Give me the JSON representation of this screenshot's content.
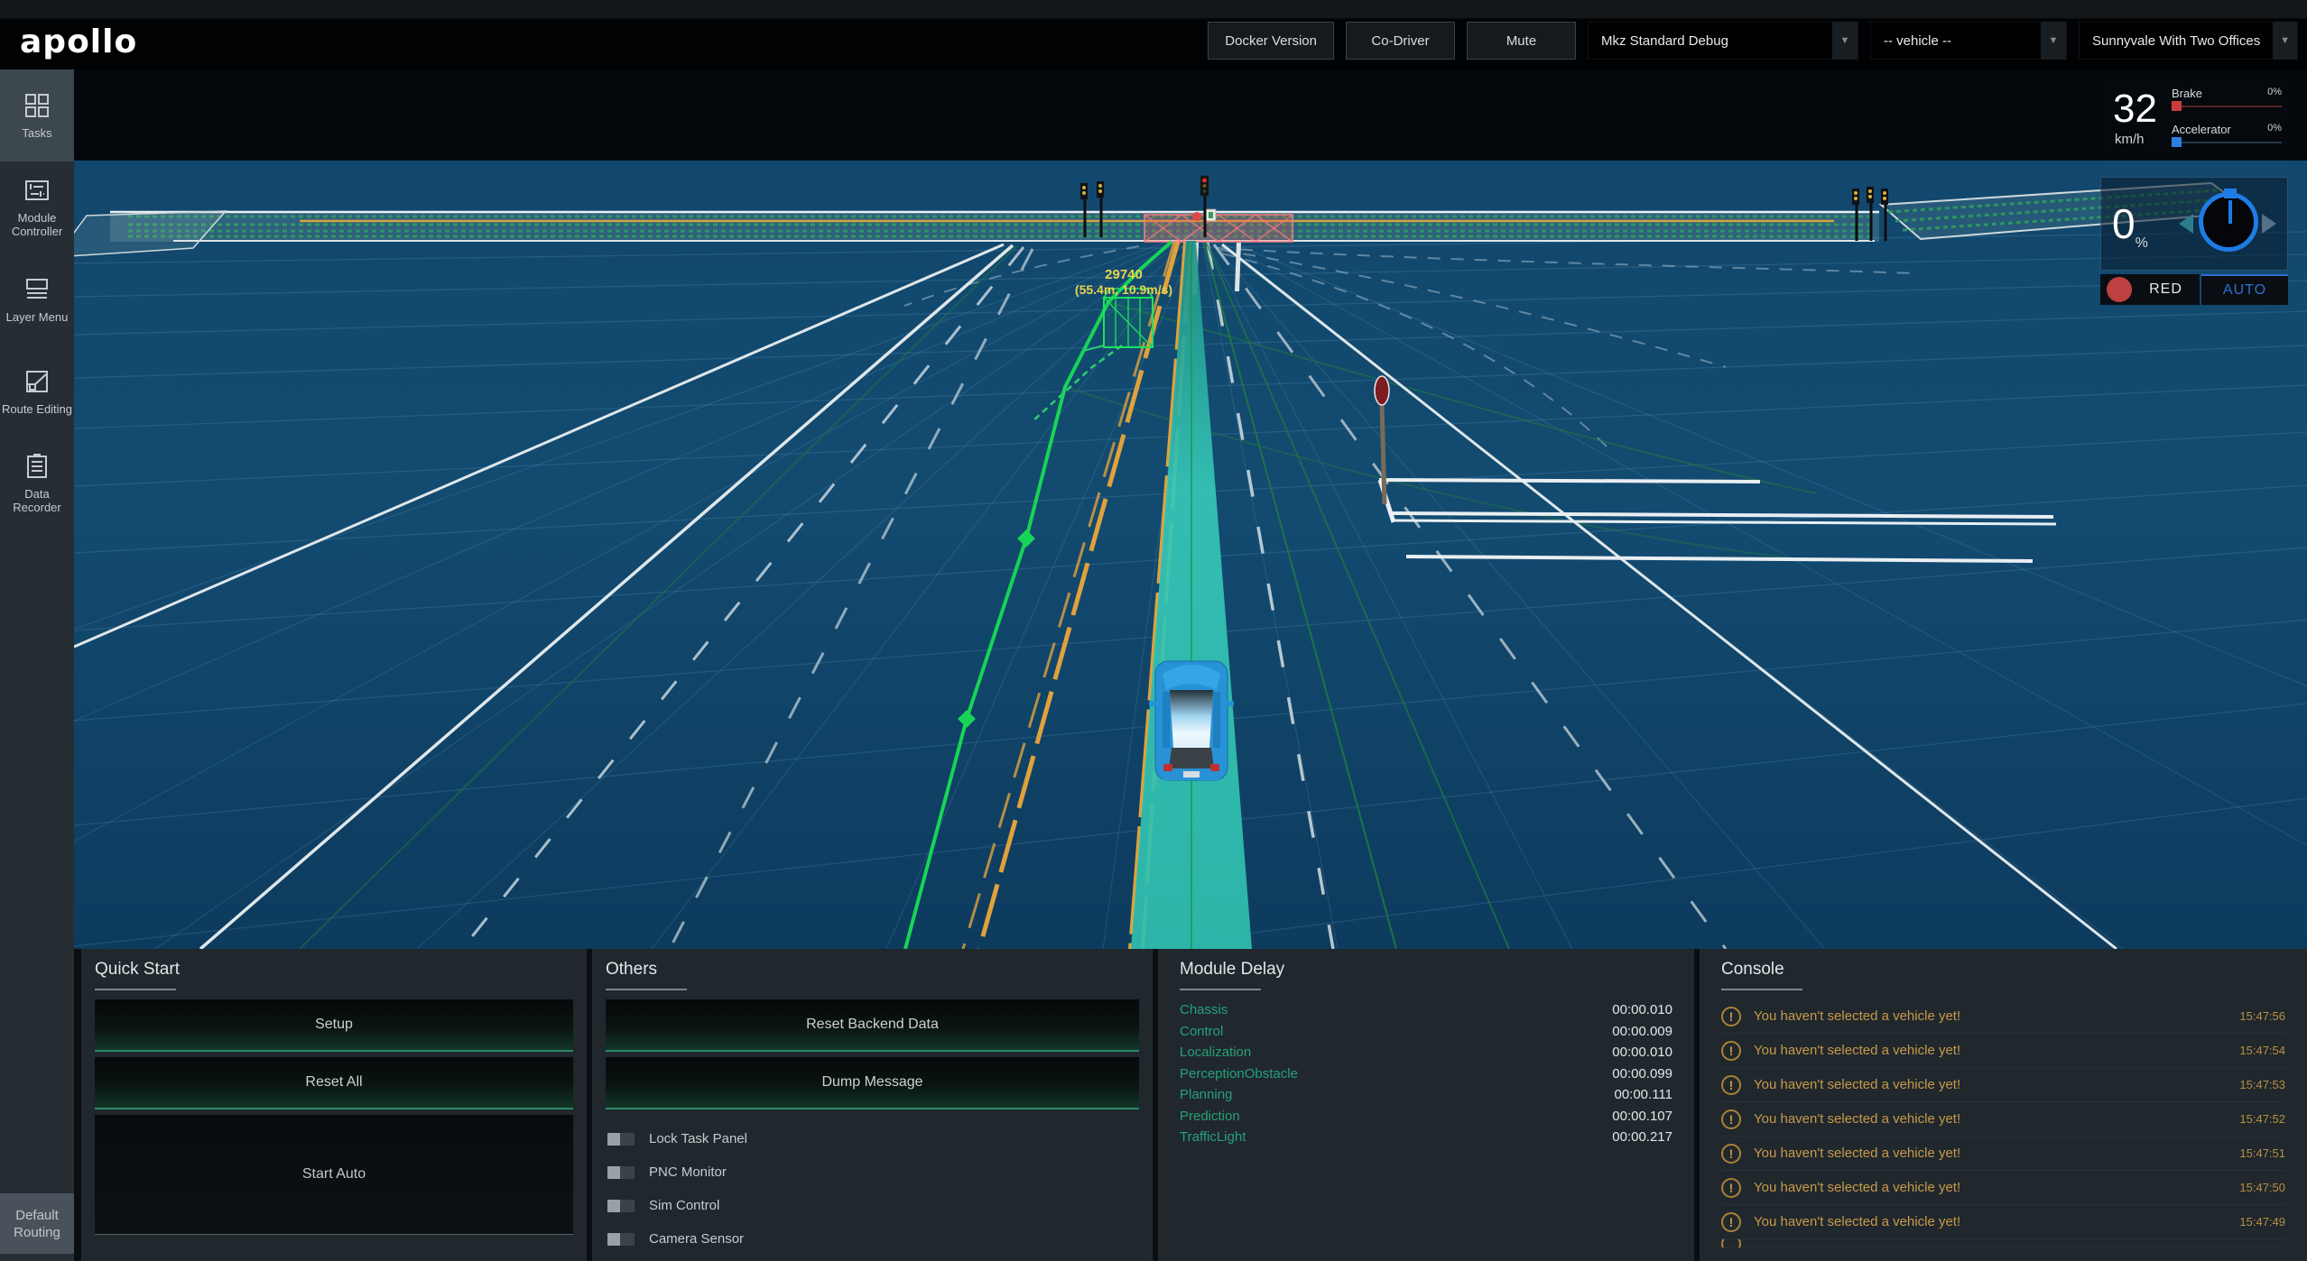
{
  "topbar": {
    "logo": "apollo",
    "buttons": [
      {
        "label": "Docker Version"
      },
      {
        "label": "Co-Driver"
      },
      {
        "label": "Mute"
      }
    ],
    "selects": [
      {
        "value": "Mkz Standard Debug"
      },
      {
        "value": "-- vehicle --"
      },
      {
        "value": "Sunnyvale With Two Offices"
      }
    ],
    "dropdown_arrow": "▼"
  },
  "sidebar": {
    "items": [
      {
        "label": "Tasks"
      },
      {
        "label": "Module Controller"
      },
      {
        "label": "Layer Menu"
      },
      {
        "label": "Route Editing"
      },
      {
        "label": "Data Recorder"
      }
    ],
    "footer": "Default Routing"
  },
  "dashboard": {
    "speed_value": "32",
    "speed_unit": "km/h",
    "brake_label": "Brake",
    "brake_value": "0%",
    "accelerator_label": "Accelerator",
    "accelerator_value": "0%",
    "steering_value": "0",
    "steering_unit": "%",
    "signal_label": "RED",
    "mode_label": "AUTO"
  },
  "scene": {
    "obstacle_id": "29740",
    "obstacle_info": "(55.4m, 10.9m/s)"
  },
  "panels": {
    "quick_start": {
      "title": "Quick Start",
      "buttons": [
        {
          "label": "Setup"
        },
        {
          "label": "Reset All"
        },
        {
          "label": "Start Auto"
        }
      ]
    },
    "others": {
      "title": "Others",
      "buttons": [
        {
          "label": "Reset Backend Data"
        },
        {
          "label": "Dump Message"
        }
      ],
      "toggles": [
        {
          "label": "Lock Task Panel",
          "on": false
        },
        {
          "label": "PNC Monitor",
          "on": false
        },
        {
          "label": "Sim Control",
          "on": false
        },
        {
          "label": "Camera Sensor",
          "on": false
        }
      ]
    },
    "module_delay": {
      "title": "Module Delay",
      "rows": [
        {
          "name": "Chassis",
          "value": "00:00.010"
        },
        {
          "name": "Control",
          "value": "00:00.009"
        },
        {
          "name": "Localization",
          "value": "00:00.010"
        },
        {
          "name": "PerceptionObstacle",
          "value": "00:00.099"
        },
        {
          "name": "Planning",
          "value": "00:00.111"
        },
        {
          "name": "Prediction",
          "value": "00:00.107"
        },
        {
          "name": "TrafficLight",
          "value": "00:00.217"
        }
      ]
    },
    "console": {
      "title": "Console",
      "warning_glyph": "!",
      "entries": [
        {
          "message": "You haven't selected a vehicle yet!",
          "time": "15:47:56"
        },
        {
          "message": "You haven't selected a vehicle yet!",
          "time": "15:47:54"
        },
        {
          "message": "You haven't selected a vehicle yet!",
          "time": "15:47:53"
        },
        {
          "message": "You haven't selected a vehicle yet!",
          "time": "15:47:52"
        },
        {
          "message": "You haven't selected a vehicle yet!",
          "time": "15:47:51"
        },
        {
          "message": "You haven't selected a vehicle yet!",
          "time": "15:47:50"
        },
        {
          "message": "You haven't selected a vehicle yet!",
          "time": "15:47:49"
        }
      ]
    }
  },
  "colors": {
    "accent_green": "#26a07b",
    "warning_amber": "#c89a4a",
    "auto_blue": "#2b6fd2",
    "signal_red": "#bf4040",
    "route_green": "#17d457",
    "trajectory_cyan": "#35c3b2",
    "lane_orange": "#e0a23c"
  }
}
